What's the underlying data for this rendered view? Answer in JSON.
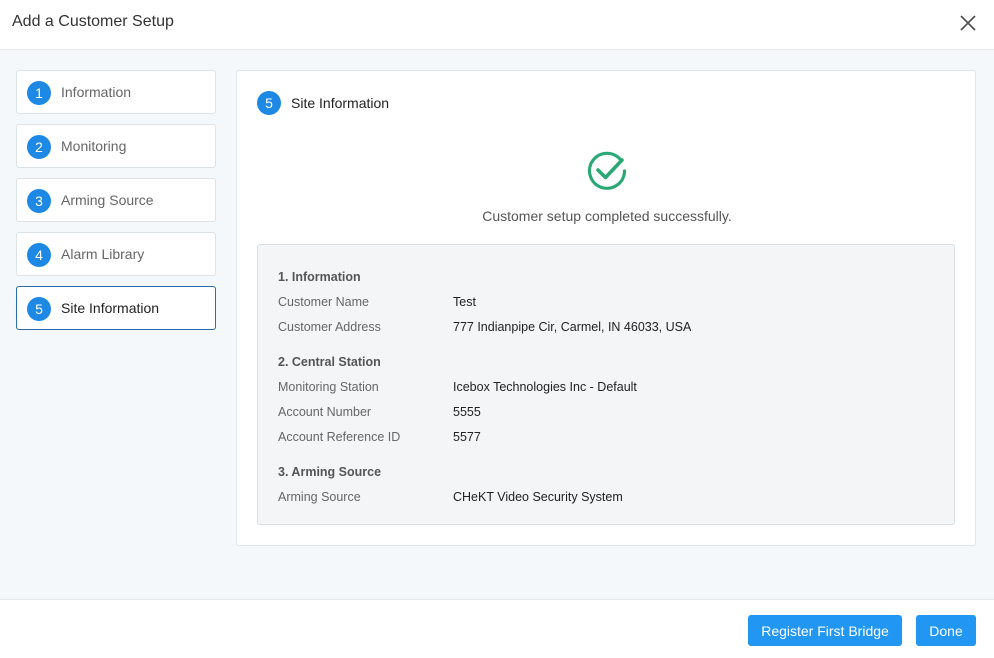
{
  "dialog": {
    "title": "Add a Customer Setup"
  },
  "steps": [
    {
      "num": "1",
      "label": "Information"
    },
    {
      "num": "2",
      "label": "Monitoring"
    },
    {
      "num": "3",
      "label": "Arming Source"
    },
    {
      "num": "4",
      "label": "Alarm Library"
    },
    {
      "num": "5",
      "label": "Site Information"
    }
  ],
  "main": {
    "step_num": "5",
    "title": "Site Information",
    "success_message": "Customer setup completed successfully.",
    "summary": {
      "information": {
        "heading": "1. Information",
        "customer_name_label": "Customer Name",
        "customer_name": "Test",
        "customer_address_label": "Customer Address",
        "customer_address": "777 Indianpipe Cir, Carmel, IN 46033, USA"
      },
      "central_station": {
        "heading": "2. Central Station",
        "monitoring_station_label": "Monitoring Station",
        "monitoring_station": "Icebox Technologies Inc - Default",
        "account_number_label": "Account Number",
        "account_number": "5555",
        "account_reference_label": "Account Reference ID",
        "account_reference": "5577"
      },
      "arming_source": {
        "heading": "3. Arming Source",
        "arming_source_label": "Arming Source",
        "arming_source": "CHeKT Video Security System"
      }
    }
  },
  "footer": {
    "register_label": "Register First Bridge",
    "done_label": "Done"
  },
  "colors": {
    "accent": "#1e88e5",
    "button": "#2196f3",
    "success": "#2aa876",
    "active_border": "#2a6cae"
  },
  "icons": {
    "close": "close-icon",
    "success": "check-circle-icon"
  }
}
